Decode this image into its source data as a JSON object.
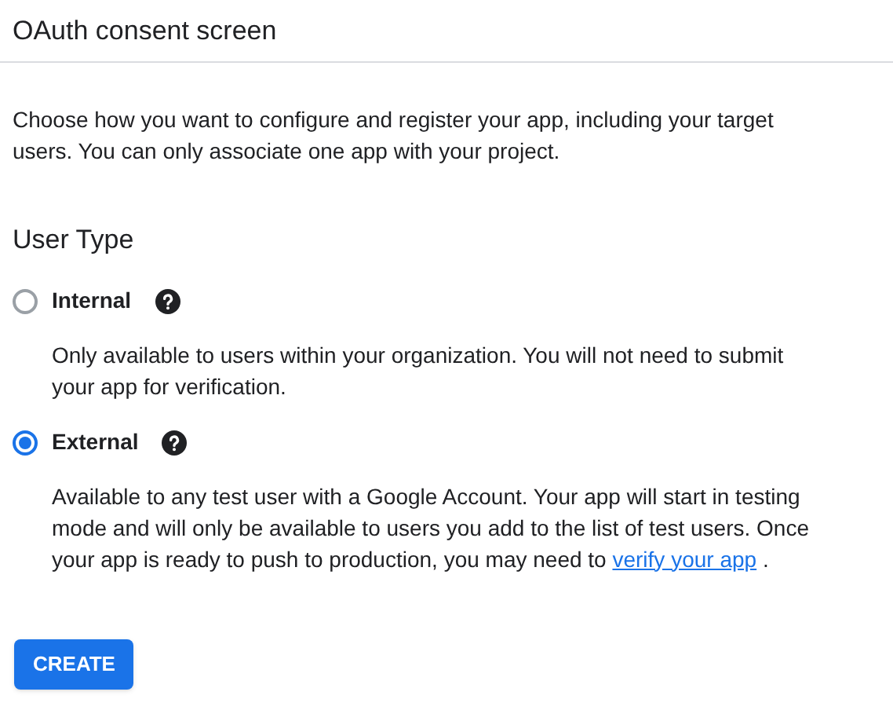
{
  "header": {
    "title": "OAuth consent screen"
  },
  "intro": "Choose how you want to configure and register your app, including your target users. You can only associate one app with your project.",
  "user_type": {
    "heading": "User Type",
    "options": [
      {
        "label": "Internal",
        "selected": false,
        "description": "Only available to users within your organization. You will not need to submit your app for verification."
      },
      {
        "label": "External",
        "selected": true,
        "description": "Available to any test user with a Google Account. Your app will start in testing mode and will only be available to users you add to the list of test users. Once your app is ready to push to production, you may need to",
        "link": "verify your app",
        "after_link": "."
      }
    ]
  },
  "button": "CREATE"
}
